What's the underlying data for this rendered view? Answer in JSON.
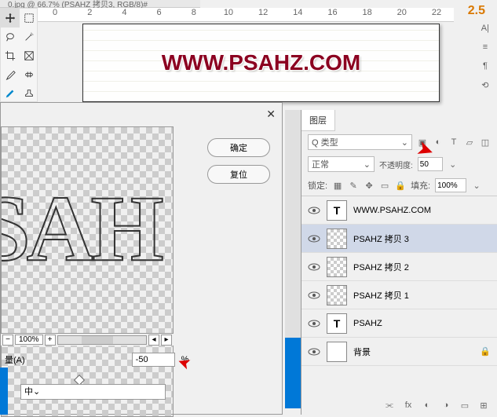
{
  "tab": {
    "title": "0.jpg @ 66.7% (PSAHZ 拷贝3, RGB/8)#"
  },
  "ruler": [
    "0",
    "2",
    "4",
    "6",
    "8",
    "10",
    "12",
    "14",
    "16",
    "18",
    "20",
    "22"
  ],
  "right_badge": "2.5",
  "canvas": {
    "text": "WWW.PSAHZ.COM"
  },
  "dialog": {
    "ok": "确定",
    "reset": "复位",
    "zoom": "100%",
    "amount_label": "量(A)",
    "amount_value": "-50",
    "amount_unit": "%",
    "select_value": "中"
  },
  "layers": {
    "tab": "图层",
    "type_label": "Q 类型",
    "blend": "正常",
    "opacity_label": "不透明度:",
    "opacity_value": "50",
    "lock_label": "锁定:",
    "fill_label": "填充:",
    "fill_value": "100%",
    "items": [
      {
        "name": "WWW.PSAHZ.COM",
        "type": "T"
      },
      {
        "name": "PSAHZ 拷贝 3",
        "type": "img"
      },
      {
        "name": "PSAHZ 拷贝 2",
        "type": "img"
      },
      {
        "name": "PSAHZ 拷贝 1",
        "type": "img"
      },
      {
        "name": "PSAHZ",
        "type": "T"
      },
      {
        "name": "背景",
        "type": "bg"
      }
    ]
  }
}
